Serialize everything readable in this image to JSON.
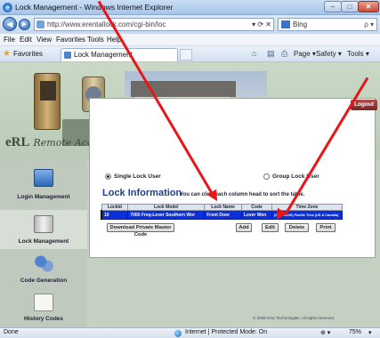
{
  "browser": {
    "title": "Lock Management - Windows Internet Explorer",
    "url": "http://www.erentallock.com/cgi-bin/loc",
    "search_engine": "Bing",
    "minimize": "–",
    "maximize": "□",
    "close": "✕",
    "back": "◀",
    "forward": "▶",
    "url_controls": "▾ ⟳ ✕",
    "search_glyph": "ρ ▾"
  },
  "menu": [
    "File",
    "Edit",
    "View",
    "Favorites",
    "Tools",
    "Help"
  ],
  "favorites_bar": {
    "favorites_label": "Favorites",
    "tab_label": "Lock Management",
    "commands": [
      "Page ▾",
      "Safety ▾",
      "Tools ▾"
    ]
  },
  "banner": {
    "brand": "eRL",
    "tagline": "Remote Access Controller"
  },
  "sidebar": [
    {
      "label": "Login Management",
      "icon": "monitor-icon",
      "active": false
    },
    {
      "label": "Lock Management",
      "icon": "lock-icon",
      "active": true
    },
    {
      "label": "Code Generation",
      "icon": "gears-icon",
      "active": false
    },
    {
      "label": "History Codes",
      "icon": "document-icon",
      "active": false
    }
  ],
  "content": {
    "logout": "Logout",
    "single_lock_user": "Single Lock User",
    "group_lock_user": "Group Lock User",
    "section_title": "Lock Information",
    "hint": "You can click each column head to sort the table.",
    "table": {
      "columns": [
        "LockId",
        "Lock Model",
        "Lock Name",
        "Code",
        "Time Zone"
      ],
      "rows": [
        [
          "10",
          "7000 Freq-Lever Southern Wor",
          "Front Door",
          "Lever Wen",
          "(GMT-08:00) Pacific Time (US & Canada)"
        ]
      ]
    },
    "buttons": {
      "download_master": "Download Private Master Code",
      "add": "Add",
      "edit": "Edit",
      "delete": "Delete",
      "print": "Print"
    },
    "footer": "© 2008 KSC Technologies. All rights reserved."
  },
  "statusbar": {
    "left": "Done",
    "zone": "Internet | Protected Mode: On",
    "zoom": "75%"
  },
  "colors": {
    "annotation_arrow": "#e8151a",
    "selected_row": "#0b2fd8",
    "title_blue": "#1e3f8d"
  }
}
